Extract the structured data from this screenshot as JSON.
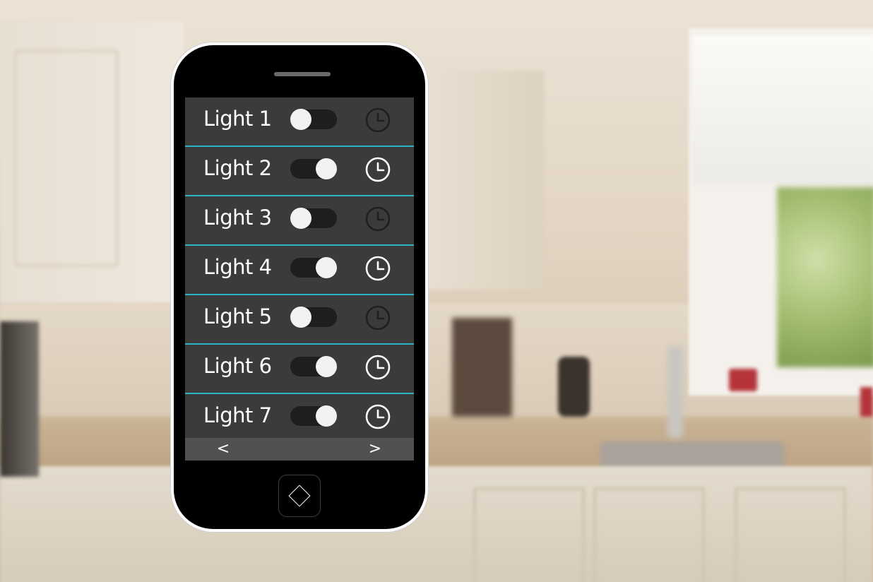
{
  "lights": [
    {
      "label": "Light 1",
      "state": "off"
    },
    {
      "label": "Light 2",
      "state": "on"
    },
    {
      "label": "Light 3",
      "state": "off"
    },
    {
      "label": "Light 4",
      "state": "on"
    },
    {
      "label": "Light 5",
      "state": "off"
    },
    {
      "label": "Light 6",
      "state": "on"
    },
    {
      "label": "Light 7",
      "state": "on"
    }
  ],
  "nav": {
    "prev": "<",
    "next": ">"
  },
  "colors": {
    "accent": "#27b4c4",
    "row_bg": "#3b3b3b",
    "footer_bg": "#515151",
    "clock_active": "#ffffff",
    "clock_inactive": "#1f1f1f"
  },
  "icons": {
    "clock": "clock-icon",
    "home": "diamond-icon"
  }
}
